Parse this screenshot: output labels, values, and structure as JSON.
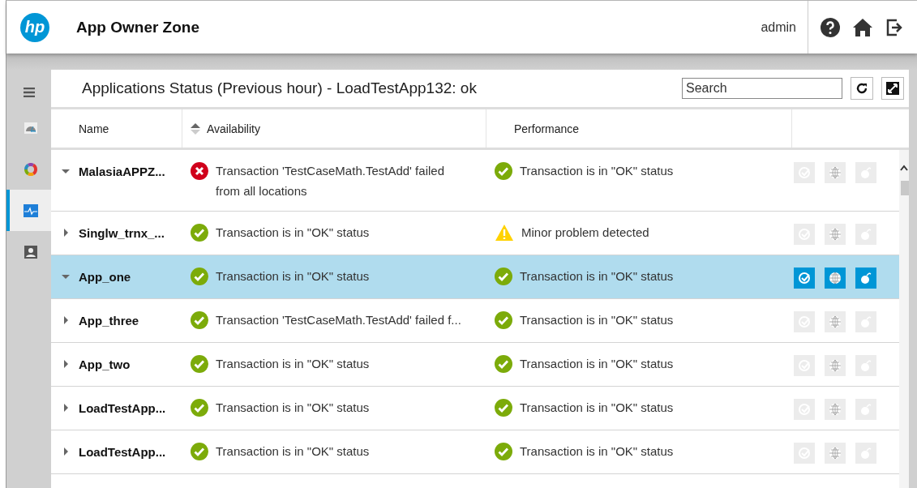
{
  "header": {
    "logo": "hp",
    "title": "App Owner Zone",
    "user": "admin"
  },
  "sidebar": {
    "items": [
      {
        "kind": "gauge",
        "selected": false
      },
      {
        "kind": "ring",
        "selected": false
      },
      {
        "kind": "pulse",
        "selected": true
      },
      {
        "kind": "person",
        "selected": false
      }
    ]
  },
  "panel": {
    "title": "Applications Status (Previous hour) - LoadTestApp132: ok",
    "search": {
      "placeholder": "Search"
    }
  },
  "table": {
    "columns": [
      "Name",
      "Availability",
      "Performance"
    ],
    "rows": [
      {
        "name": "MalasiaAPPZ...",
        "expanded": true,
        "selected": false,
        "availability": {
          "kind": "error",
          "text": "Transaction 'TestCaseMath.TestAdd' failed from all locations"
        },
        "performance": {
          "kind": "ok",
          "text": "Transaction is in \"OK\" status"
        }
      },
      {
        "name": "Singlw_trnx_...",
        "expanded": false,
        "selected": false,
        "availability": {
          "kind": "ok",
          "text": "Transaction is in \"OK\" status"
        },
        "performance": {
          "kind": "warning",
          "text": "Minor problem detected"
        }
      },
      {
        "name": "App_one",
        "expanded": true,
        "selected": true,
        "availability": {
          "kind": "ok",
          "text": "Transaction is in \"OK\" status"
        },
        "performance": {
          "kind": "ok",
          "text": "Transaction is in \"OK\" status"
        }
      },
      {
        "name": "App_three",
        "expanded": false,
        "selected": false,
        "availability": {
          "kind": "ok",
          "text": "Transaction 'TestCaseMath.TestAdd' failed f..."
        },
        "performance": {
          "kind": "ok",
          "text": "Transaction is in \"OK\" status"
        }
      },
      {
        "name": "App_two",
        "expanded": false,
        "selected": false,
        "availability": {
          "kind": "ok",
          "text": "Transaction is in \"OK\" status"
        },
        "performance": {
          "kind": "ok",
          "text": "Transaction is in \"OK\" status"
        }
      },
      {
        "name": "LoadTestApp...",
        "expanded": false,
        "selected": false,
        "availability": {
          "kind": "ok",
          "text": "Transaction is in \"OK\" status"
        },
        "performance": {
          "kind": "ok",
          "text": "Transaction is in \"OK\" status"
        }
      },
      {
        "name": "LoadTestApp...",
        "expanded": false,
        "selected": false,
        "availability": {
          "kind": "ok",
          "text": "Transaction is in \"OK\" status"
        },
        "performance": {
          "kind": "ok",
          "text": "Transaction is in \"OK\" status"
        }
      }
    ]
  }
}
